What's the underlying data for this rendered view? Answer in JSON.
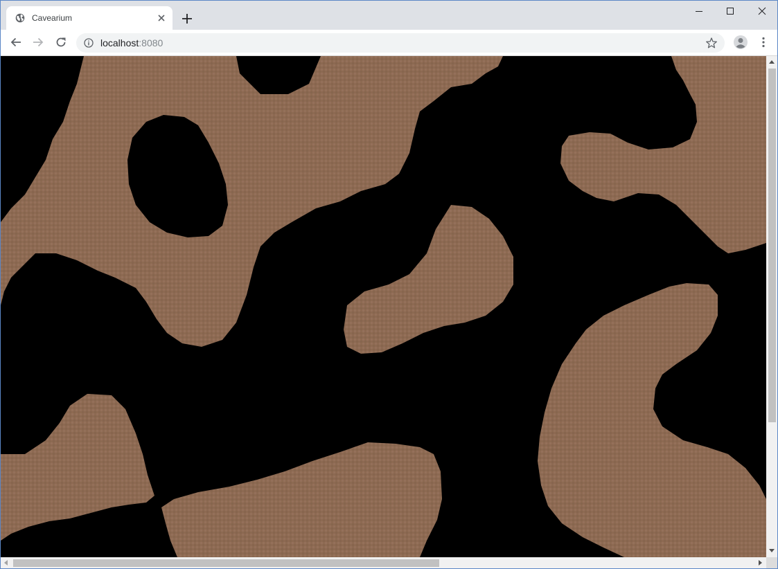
{
  "browser": {
    "tab": {
      "title": "Cavearium",
      "favicon_icon": "globe-icon",
      "close_icon": "close-icon"
    },
    "new_tab_icon": "plus-icon",
    "window_controls": [
      "minimize-icon",
      "maximize-icon",
      "close-icon"
    ],
    "nav": {
      "back_icon": "arrow-left-icon",
      "forward_icon": "arrow-right-icon",
      "reload_icon": "reload-icon"
    },
    "address": {
      "host": "localhost",
      "port": ":8080",
      "info_icon": "info-icon",
      "bookmark_icon": "star-icon"
    },
    "profile_icon": "account-circle-icon",
    "menu_icon": "kebab-menu-icon"
  },
  "colors": {
    "cave_floor": "#8d6a52",
    "rock": "#000000",
    "tab_bg": "#dee1e6",
    "omnibox_bg": "#f1f3f4",
    "window_border": "#5a86c6"
  },
  "scrollbars": {
    "vertical_position": 0,
    "horizontal_position": 0
  }
}
